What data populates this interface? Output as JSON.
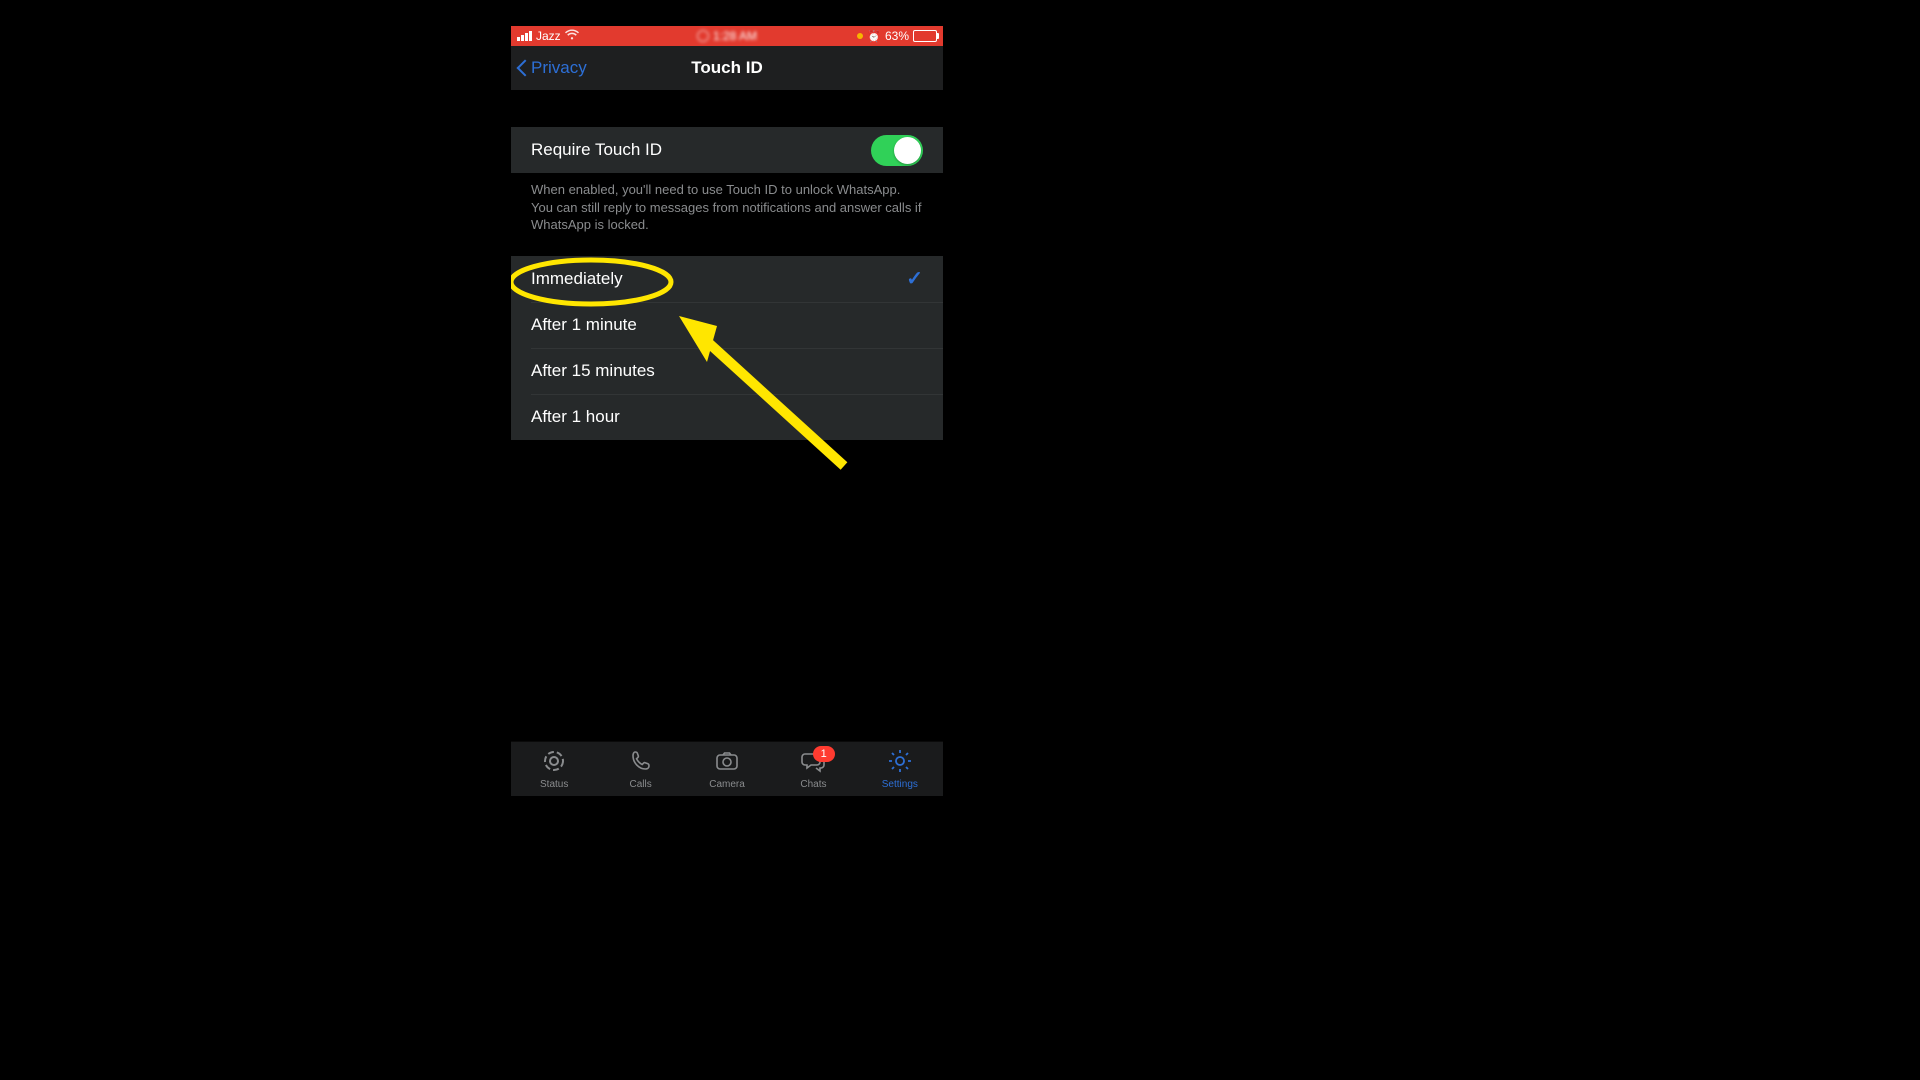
{
  "statusbar": {
    "carrier": "Jazz",
    "time": "1:28 AM",
    "battery_pct": "63%"
  },
  "nav": {
    "back_label": "Privacy",
    "title": "Touch ID"
  },
  "require": {
    "label": "Require Touch ID",
    "toggle_on": true,
    "footer": "When enabled, you'll need to use Touch ID to unlock WhatsApp. You can still reply to messages from notifications and answer calls if WhatsApp is locked."
  },
  "options": [
    {
      "label": "Immediately",
      "selected": true
    },
    {
      "label": "After 1 minute",
      "selected": false
    },
    {
      "label": "After 15 minutes",
      "selected": false
    },
    {
      "label": "After 1 hour",
      "selected": false
    }
  ],
  "tabs": {
    "status": "Status",
    "calls": "Calls",
    "camera": "Camera",
    "chats": "Chats",
    "settings": "Settings",
    "chats_badge": "1",
    "active": "settings"
  },
  "annotation": {
    "highlighted_option_index": 0,
    "color": "#ffe600"
  }
}
